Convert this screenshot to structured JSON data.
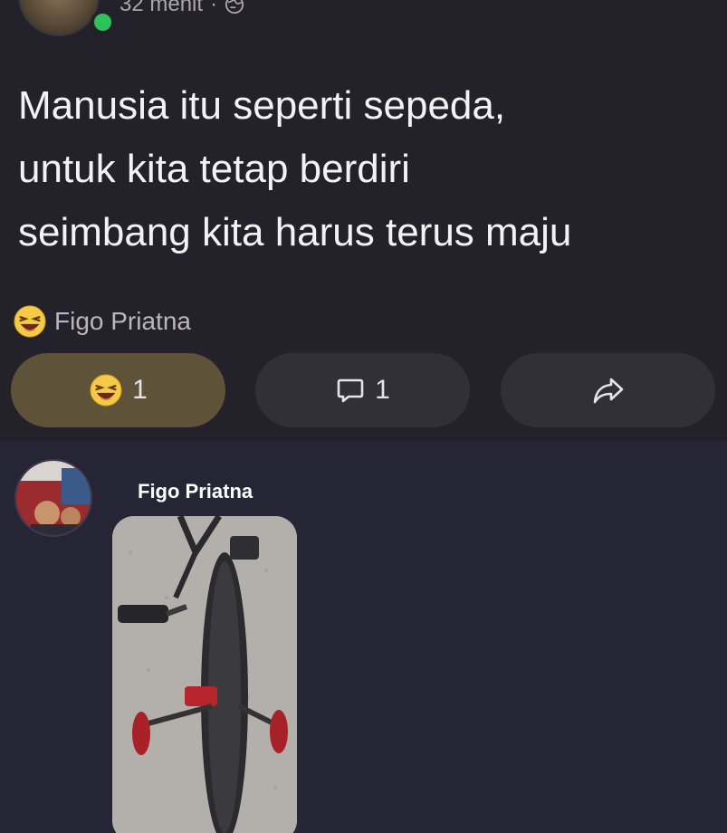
{
  "post": {
    "meta_time": "32 menit",
    "meta_separator": "·",
    "text": "Manusia itu seperti sepeda,\nuntuk kita tetap berdiri\nseimbang kita harus terus maju",
    "reactor_name": "Figo Priatna"
  },
  "actions": {
    "react_count": "1",
    "comment_count": "1"
  },
  "comment": {
    "author": "Figo Priatna"
  },
  "colors": {
    "background": "#232129",
    "react_pill": "#5e5338",
    "pill": "#312f38",
    "online": "#2fc25b",
    "comment_section": "#262536"
  },
  "icons": [
    "globe-icon",
    "laughing-emoji-icon",
    "comment-icon",
    "share-icon"
  ]
}
